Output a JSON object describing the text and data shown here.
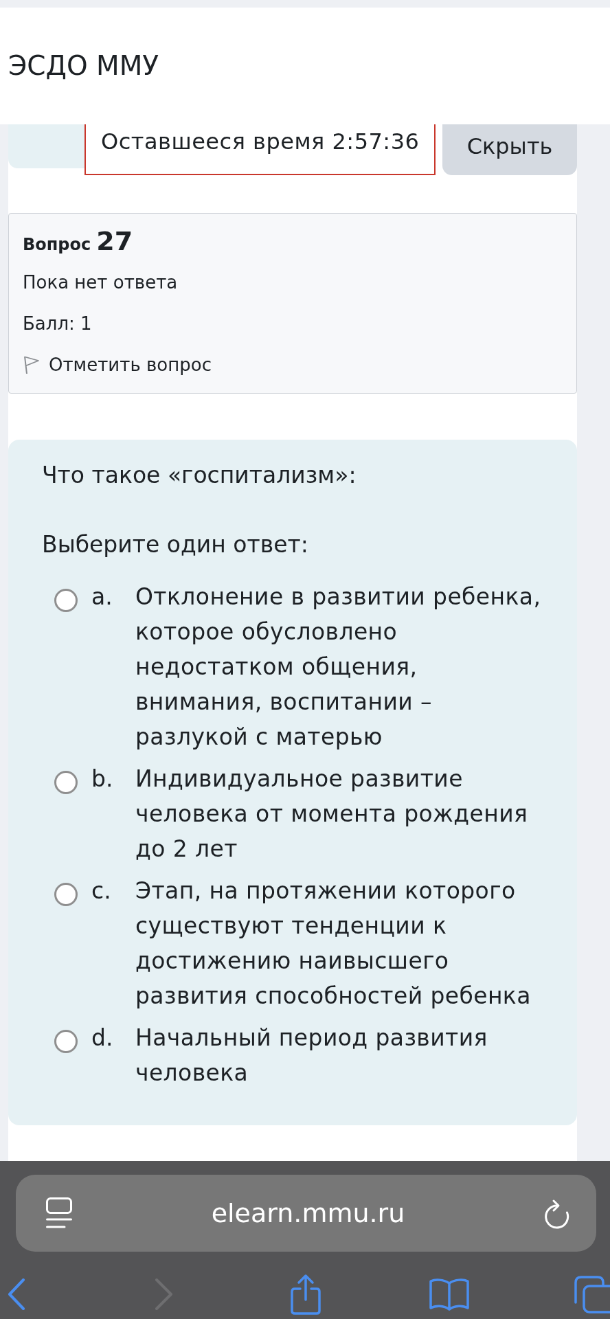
{
  "header": {
    "title": "ЭСДО ММУ"
  },
  "timer": {
    "label": "Оставшееся время 2:57:36",
    "hide_button": "Скрыть"
  },
  "question_info": {
    "label": "Вопрос",
    "number": "27",
    "status": "Пока нет ответа",
    "score": "Балл: 1",
    "flag_link": "Отметить вопрос",
    "flagged": false
  },
  "question": {
    "text": "Что такое «госпитализм»:",
    "prompt": "Выберите один ответ:",
    "options": [
      {
        "letter": "a.",
        "text": "Отклонение в развитии ребенка, которое обусловлено недостатком общения, внимания, воспитании – разлукой с матерью",
        "selected": false
      },
      {
        "letter": "b.",
        "text": "Индивидуальное развитие человека от момента рождения до 2 лет",
        "selected": false
      },
      {
        "letter": "c.",
        "text": "Этап, на протяжении которого существуют тенденции к достижению наивысшего развития способностей ребенка",
        "selected": false
      },
      {
        "letter": "d.",
        "text": "Начальный период развития человека",
        "selected": false
      }
    ]
  },
  "browser": {
    "url": "elearn.mmu.ru",
    "back_disabled": false,
    "forward_disabled": true
  }
}
